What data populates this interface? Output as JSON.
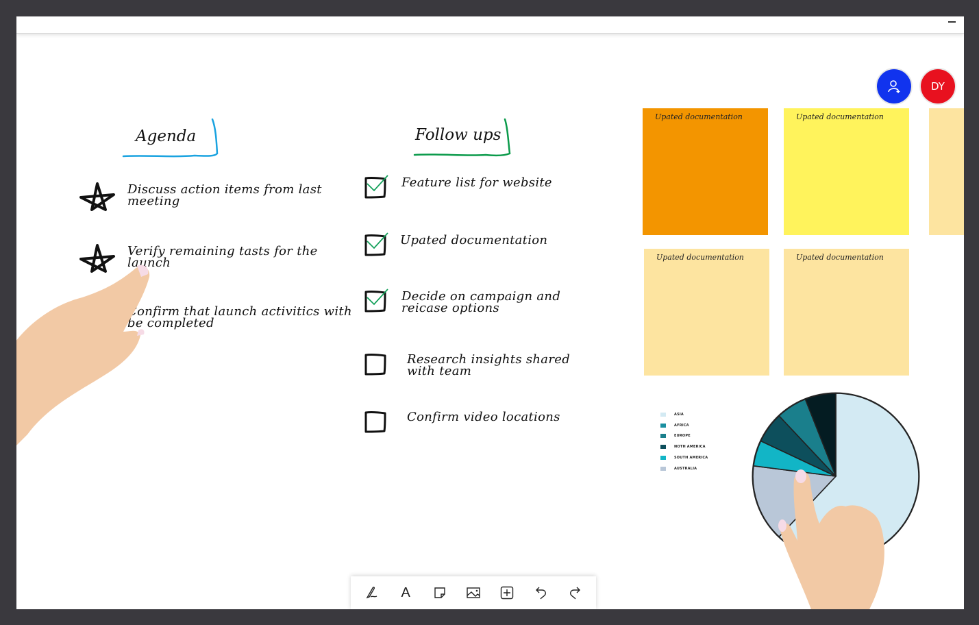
{
  "window": {
    "minimize_icon": "minimize-icon"
  },
  "participants": {
    "add_user_icon": "person-add-icon",
    "add_user_color": "#1133ee",
    "user_initials": "DY",
    "user_color": "#e8111f"
  },
  "agenda": {
    "title": "Agenda",
    "underline_color": "#1aa3e0",
    "items": [
      {
        "line1": "Discuss action items from last",
        "line2": "meeting",
        "icon": "star-icon"
      },
      {
        "line1": "Verify remaining tasts for the",
        "line2": "launch",
        "icon": "star-icon"
      },
      {
        "line1": "Confirm that launch activitics with",
        "line2": "be completed",
        "icon": "star-icon"
      }
    ]
  },
  "follow_ups": {
    "title": "Follow ups",
    "underline_color": "#0a9a4a",
    "check_color": "#13a05a",
    "items": [
      {
        "line1": "Feature list for website",
        "line2": "",
        "checked": true
      },
      {
        "line1": "Upated documentation",
        "line2": "",
        "checked": true
      },
      {
        "line1": "Decide on campaign and",
        "line2": "reicase options",
        "checked": true
      },
      {
        "line1": "Research insights shared",
        "line2": "with team",
        "checked": false
      },
      {
        "line1": "Confirm video locations",
        "line2": "",
        "checked": false
      }
    ]
  },
  "sticky_notes": [
    {
      "text": "Upated documentation",
      "color": "#f39500"
    },
    {
      "text": "Upated documentation",
      "color": "#fff35c"
    },
    {
      "text": "",
      "color": "#fde4a0"
    },
    {
      "text": "Upated documentation",
      "color": "#fde4a0"
    },
    {
      "text": "Upated documentation",
      "color": "#fde4a0"
    }
  ],
  "chart_data": {
    "type": "pie",
    "title": "",
    "legend_position": "left",
    "categories": [
      "ASIA",
      "AFRICA",
      "EUROPE",
      "NOTH AMERICA",
      "SOUTH AMERICA",
      "AUSTRALIA"
    ],
    "legend_colors": [
      "#d3eaf3",
      "#1a8fa0",
      "#1a7f8c",
      "#0d4f5c",
      "#12b5c6",
      "#b9c7d8"
    ],
    "slices": [
      {
        "label": "ASIA",
        "value": 62,
        "color": "#d3eaf3"
      },
      {
        "label": "AUSTRALIA",
        "value": 15,
        "color": "#b9c7d8"
      },
      {
        "label": "SOUTH AMERICA",
        "value": 5,
        "color": "#12b5c6"
      },
      {
        "label": "NOTH AMERICA",
        "value": 6,
        "color": "#0d4f5c"
      },
      {
        "label": "EUROPE",
        "value": 6,
        "color": "#1a7f8c"
      },
      {
        "label": "AFRICA",
        "value": 6,
        "color": "#041c22"
      }
    ]
  },
  "toolbar": {
    "tools": [
      {
        "name": "pen-tool",
        "icon": "pen-icon"
      },
      {
        "name": "text-tool",
        "icon": "text-icon",
        "glyph": "A"
      },
      {
        "name": "sticky-note-tool",
        "icon": "sticky-note-icon"
      },
      {
        "name": "image-tool",
        "icon": "image-icon"
      },
      {
        "name": "add-tool",
        "icon": "plus-box-icon"
      },
      {
        "name": "undo-button",
        "icon": "undo-icon"
      },
      {
        "name": "redo-button",
        "icon": "redo-icon"
      }
    ]
  }
}
